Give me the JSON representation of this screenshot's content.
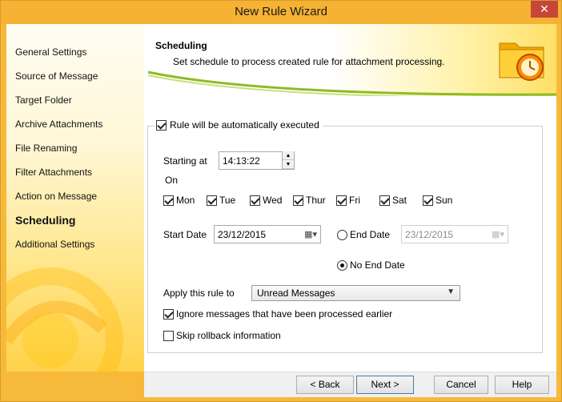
{
  "window": {
    "title": "New Rule Wizard",
    "close_label": "✕"
  },
  "sidebar": {
    "items": [
      {
        "label": "General Settings"
      },
      {
        "label": "Source of Message"
      },
      {
        "label": "Target Folder"
      },
      {
        "label": "Archive Attachments"
      },
      {
        "label": "File Renaming"
      },
      {
        "label": "Filter Attachments"
      },
      {
        "label": "Action on Message"
      },
      {
        "label": "Scheduling",
        "active": true
      },
      {
        "label": "Additional Settings"
      }
    ]
  },
  "header": {
    "title": "Scheduling",
    "subtitle": "Set schedule to process created rule for attachment processing."
  },
  "schedule": {
    "auto_exec_label": "Rule will be automatically executed",
    "auto_exec_checked": true,
    "starting_at_label": "Starting at",
    "starting_at_value": "14:13:22",
    "on_label": "On",
    "days": [
      {
        "label": "Mon",
        "checked": true
      },
      {
        "label": "Tue",
        "checked": true
      },
      {
        "label": "Wed",
        "checked": true
      },
      {
        "label": "Thur",
        "checked": true
      },
      {
        "label": "Fri",
        "checked": true
      },
      {
        "label": "Sat",
        "checked": true
      },
      {
        "label": "Sun",
        "checked": true
      }
    ],
    "start_date_label": "Start Date",
    "start_date_value": "23/12/2015",
    "end_date_label": "End Date",
    "end_date_value": "23/12/2015",
    "no_end_date_label": "No End Date",
    "end_choice": "no_end_date",
    "apply_rule_label": "Apply this rule to",
    "apply_rule_value": "Unread Messages",
    "ignore_processed_label": "Ignore messages that have been processed earlier",
    "ignore_processed_checked": true,
    "skip_rollback_label": "Skip rollback information",
    "skip_rollback_checked": false
  },
  "footer": {
    "back_label": "< Back",
    "next_label": "Next >",
    "cancel_label": "Cancel",
    "help_label": "Help"
  },
  "colors": {
    "title_bar": "#f5b233",
    "close_button": "#c7463a",
    "accent": "#f7b93a"
  }
}
